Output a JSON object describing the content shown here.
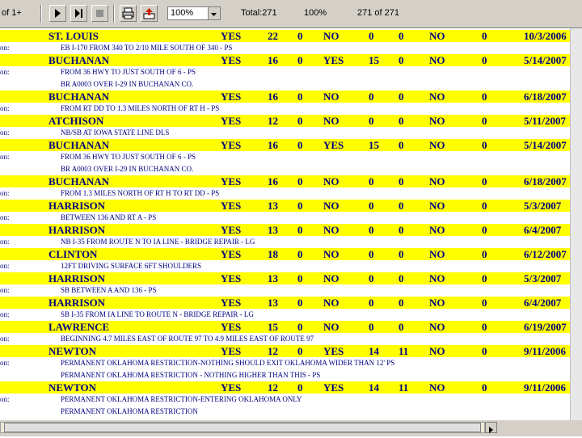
{
  "toolbar": {
    "page_of": "of 1+",
    "zoom": "100%",
    "total": "Total:271",
    "percent": "100%",
    "record_count": "271 of 271",
    "icons": [
      "next-page-icon",
      "last-page-icon",
      "stop-icon",
      "print-icon",
      "export-icon",
      "dropdown-arrow-icon"
    ]
  },
  "colors": {
    "header_bg": "#ffff00",
    "text": "#000080",
    "toolbar": "#d4d0c8"
  },
  "detail_label": "on:",
  "detail_label_alt": "on:",
  "records": [
    {
      "county": "ST. LOUIS",
      "req": "YES",
      "a": "22",
      "b": "0",
      "c": "NO",
      "d": "0",
      "e": "0",
      "f": "NO",
      "g": "0",
      "date": "10/3/2006",
      "details": [
        {
          "label": "on:",
          "text": "EB I-170 FROM 340 TO 2/10 MILE SOUTH OF 340 - PS"
        }
      ]
    },
    {
      "county": "BUCHANAN",
      "req": "YES",
      "a": "16",
      "b": "0",
      "c": "YES",
      "d": "15",
      "e": "0",
      "f": "NO",
      "g": "0",
      "date": "5/14/2007",
      "details": [
        {
          "label": "on:",
          "text": "FROM 36 HWY TO JUST SOUTH OF 6 - PS"
        },
        {
          "label": "",
          "text": "BR A0003 OVER I-29 IN BUCHANAN CO."
        }
      ]
    },
    {
      "county": "BUCHANAN",
      "req": "YES",
      "a": "16",
      "b": "0",
      "c": "NO",
      "d": "0",
      "e": "0",
      "f": "NO",
      "g": "0",
      "date": "6/18/2007",
      "details": [
        {
          "label": "on:",
          "text": "FROM RT DD TO 1.3 MILES NORTH OF RT H - PS"
        }
      ]
    },
    {
      "county": "ATCHISON",
      "req": "YES",
      "a": "12",
      "b": "0",
      "c": "NO",
      "d": "0",
      "e": "0",
      "f": "NO",
      "g": "0",
      "date": "5/11/2007",
      "details": [
        {
          "label": "on:",
          "text": "NB/SB AT IOWA STATE LINE DLS"
        }
      ]
    },
    {
      "county": "BUCHANAN",
      "req": "YES",
      "a": "16",
      "b": "0",
      "c": "YES",
      "d": "15",
      "e": "0",
      "f": "NO",
      "g": "0",
      "date": "5/14/2007",
      "details": [
        {
          "label": "on:",
          "text": "FROM 36 HWY TO JUST SOUTH OF 6 - PS"
        },
        {
          "label": "",
          "text": "BR A0003 OVER I-29 IN BUCHANAN CO."
        }
      ]
    },
    {
      "county": "BUCHANAN",
      "req": "YES",
      "a": "16",
      "b": "0",
      "c": "NO",
      "d": "0",
      "e": "0",
      "f": "NO",
      "g": "0",
      "date": "6/18/2007",
      "details": [
        {
          "label": "on:",
          "text": "FROM 1.3 MILES NORTH OF RT H TO RT DD - PS"
        }
      ]
    },
    {
      "county": "HARRISON",
      "req": "YES",
      "a": "13",
      "b": "0",
      "c": "NO",
      "d": "0",
      "e": "0",
      "f": "NO",
      "g": "0",
      "date": "5/3/2007",
      "details": [
        {
          "label": "on:",
          "text": "BETWEEN 136 AND RT A - PS"
        }
      ]
    },
    {
      "county": "HARRISON",
      "req": "YES",
      "a": "13",
      "b": "0",
      "c": "NO",
      "d": "0",
      "e": "0",
      "f": "NO",
      "g": "0",
      "date": "6/4/2007",
      "details": [
        {
          "label": "on:",
          "text": "NB I-35 FROM ROUTE N TO IA LINE - BRIDGE REPAIR - LG"
        }
      ]
    },
    {
      "county": "CLINTON",
      "req": "YES",
      "a": "18",
      "b": "0",
      "c": "NO",
      "d": "0",
      "e": "0",
      "f": "NO",
      "g": "0",
      "date": "6/12/2007",
      "details": [
        {
          "label": "on:",
          "text": "12FT DRIVING SURFACE 6FT SHOULDERS"
        }
      ]
    },
    {
      "county": "HARRISON",
      "req": "YES",
      "a": "13",
      "b": "0",
      "c": "NO",
      "d": "0",
      "e": "0",
      "f": "NO",
      "g": "0",
      "date": "5/3/2007",
      "details": [
        {
          "label": "on:",
          "text": "SB BETWEEN A AND 136 - PS"
        }
      ]
    },
    {
      "county": "HARRISON",
      "req": "YES",
      "a": "13",
      "b": "0",
      "c": "NO",
      "d": "0",
      "e": "0",
      "f": "NO",
      "g": "0",
      "date": "6/4/2007",
      "details": [
        {
          "label": "on:",
          "text": "SB I-35 FROM IA LINE TO ROUTE N - BRIDGE REPAIR - LG"
        }
      ]
    },
    {
      "county": "LAWRENCE",
      "req": "YES",
      "a": "15",
      "b": "0",
      "c": "NO",
      "d": "0",
      "e": "0",
      "f": "NO",
      "g": "0",
      "date": "6/19/2007",
      "details": [
        {
          "label": "on:",
          "text": "BEGINNING 4.7 MILES EAST OF ROUTE 97 TO 4.9 MILES EAST OF ROUTE 97"
        }
      ]
    },
    {
      "county": "NEWTON",
      "req": "YES",
      "a": "12",
      "b": "0",
      "c": "YES",
      "d": "14",
      "e": "11",
      "f": "NO",
      "g": "0",
      "date": "9/11/2006",
      "details": [
        {
          "label": "on:",
          "text": "PERMANENT OKLAHOMA RESTRICTION-NOTHING SHOULD EXIT OKLAHOMA WIDER THAN 12' PS"
        },
        {
          "label": "",
          "text": "PERMANENT OKLAHOMA RESTRICTION - NOTHING HIGHER THAN THIS - PS"
        }
      ]
    },
    {
      "county": "NEWTON",
      "req": "YES",
      "a": "12",
      "b": "0",
      "c": "YES",
      "d": "14",
      "e": "11",
      "f": "NO",
      "g": "0",
      "date": "9/11/2006",
      "details": [
        {
          "label": "on:",
          "text": "PERMANENT OKLAHOMA RESTRICTION-ENTERING OKLAHOMA ONLY"
        },
        {
          "label": "",
          "text": "PERMANENT OKLAHOMA RESTRICTION"
        }
      ]
    }
  ]
}
